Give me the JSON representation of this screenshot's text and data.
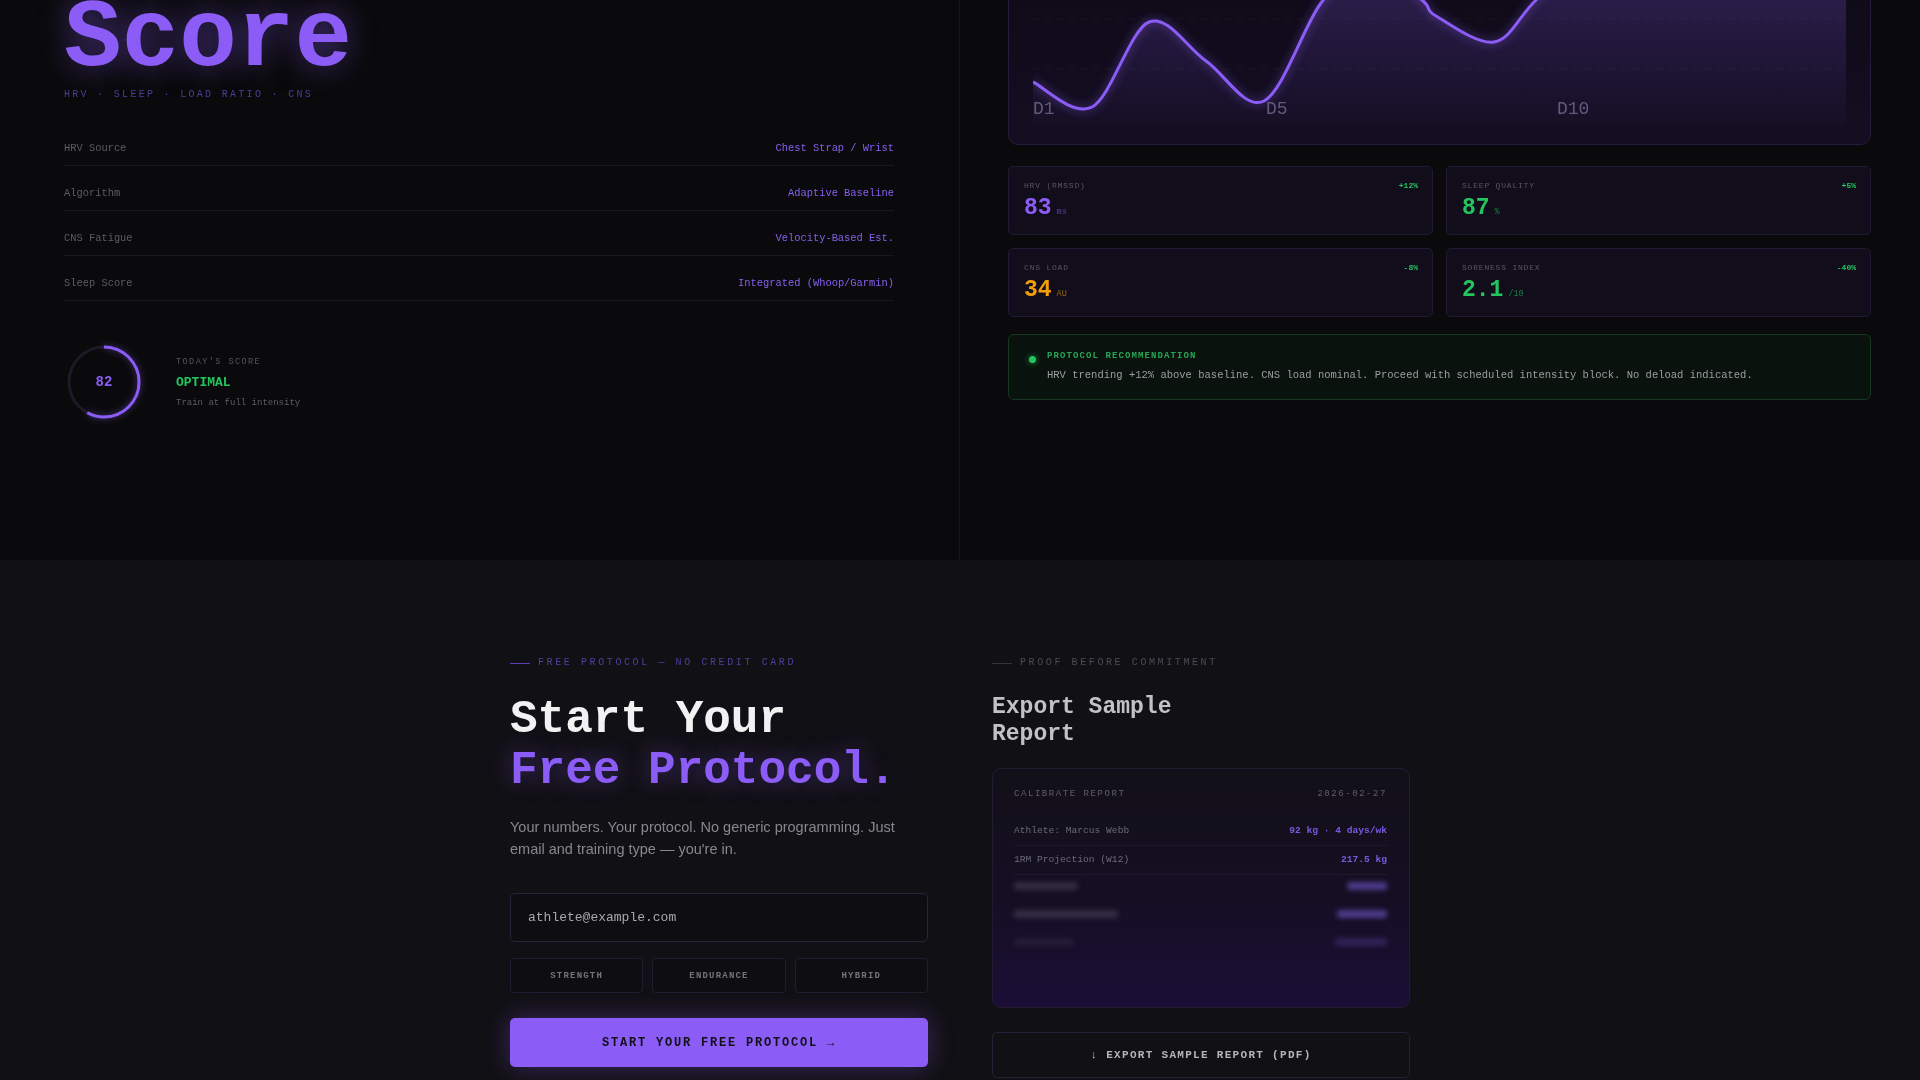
{
  "hero": {
    "title": "Score",
    "subtitle": "HRV · SLEEP · LOAD RATIO · CNS"
  },
  "specs": [
    {
      "label": "HRV Source",
      "value": "Chest Strap / Wrist"
    },
    {
      "label": "Algorithm",
      "value": "Adaptive Baseline"
    },
    {
      "label": "CNS Fatigue",
      "value": "Velocity-Based Est."
    },
    {
      "label": "Sleep Score",
      "value": "Integrated (Whoop/Garmin)"
    }
  ],
  "score": {
    "value": "82",
    "level": 0.58,
    "caption": "TODAY'S SCORE",
    "status": "OPTIMAL",
    "note": "Train at full intensity"
  },
  "trend_chart": {
    "x_labels": [
      "D1",
      "D5",
      "D10"
    ]
  },
  "metrics": [
    {
      "label": "HRV (RMSSD)",
      "change": "+12%",
      "value": "83",
      "unit": "ms",
      "color": "#8b5cf6"
    },
    {
      "label": "SLEEP QUALITY",
      "change": "+5%",
      "value": "87",
      "unit": "%",
      "color": "#22c55e"
    },
    {
      "label": "CNS LOAD",
      "change": "-8%",
      "value": "34",
      "unit": "AU",
      "color": "#f59e0b"
    },
    {
      "label": "SORENESS INDEX",
      "change": "-40%",
      "value": "2.1",
      "unit": "/10",
      "color": "#22c55e"
    }
  ],
  "recommendation": {
    "title": "PROTOCOL RECOMMENDATION",
    "text": "HRV trending +12% above baseline. CNS load nominal. Proceed with scheduled intensity block. No deload indicated."
  },
  "signup": {
    "eyebrow": "FREE PROTOCOL — NO CREDIT CARD",
    "heading": "Start Your",
    "heading_accent": "Free Protocol.",
    "description": "Your numbers. Your protocol. No generic programming. Just email and training type — you're in.",
    "email": {
      "placeholder": "athlete@example.com"
    },
    "training_types": [
      {
        "label": "STRENGTH",
        "selected": false
      },
      {
        "label": "ENDURANCE",
        "selected": false
      },
      {
        "label": "HYBRID",
        "selected": false
      }
    ],
    "submit": "START YOUR FREE PROTOCOL →"
  },
  "sample_report": {
    "eyebrow": "PROOF BEFORE COMMITMENT",
    "heading": "Export Sample Report",
    "report": {
      "title": "CALIBRATE REPORT",
      "date": "2026-02-27",
      "rows": [
        {
          "label": "Athlete: Marcus Webb",
          "value": "92 kg · 4 days/wk"
        },
        {
          "label": "1RM Projection (W12)",
          "value": "217.5 kg"
        }
      ]
    },
    "export_button": "↓ EXPORT SAMPLE REPORT (PDF)"
  }
}
